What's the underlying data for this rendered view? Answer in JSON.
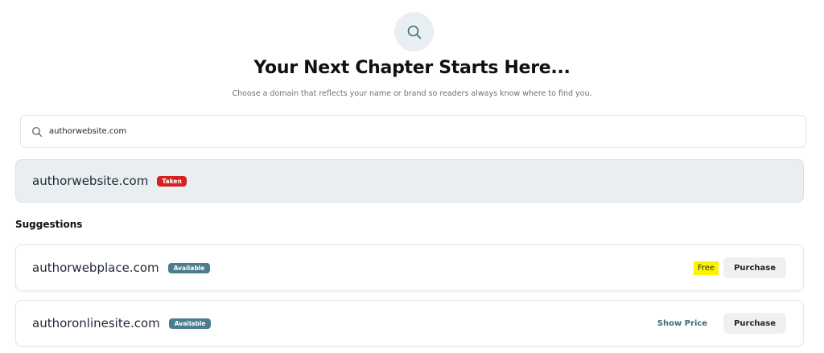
{
  "hero": {
    "icon": "search-icon"
  },
  "header": {
    "title": "Your Next Chapter Starts Here...",
    "subtitle": "Choose a domain that reflects your name or brand so readers always know where to find you."
  },
  "search": {
    "icon": "search-icon",
    "value": "authorwebsite.com",
    "placeholder": ""
  },
  "result": {
    "domain": "authorwebsite.com",
    "status": "Taken",
    "status_color": "#d92020"
  },
  "suggestions": {
    "heading": "Suggestions",
    "items": [
      {
        "domain": "authorwebplace.com",
        "status": "Available",
        "price": "Free",
        "action": "Purchase"
      },
      {
        "domain": "authoronlinesite.com",
        "status": "Available",
        "price": "Show Price",
        "action": "Purchase"
      }
    ]
  },
  "colors": {
    "accent": "#4a7d8e",
    "taken": "#d92020",
    "highlight": "#fff200",
    "result_bg": "#e9eff1"
  }
}
